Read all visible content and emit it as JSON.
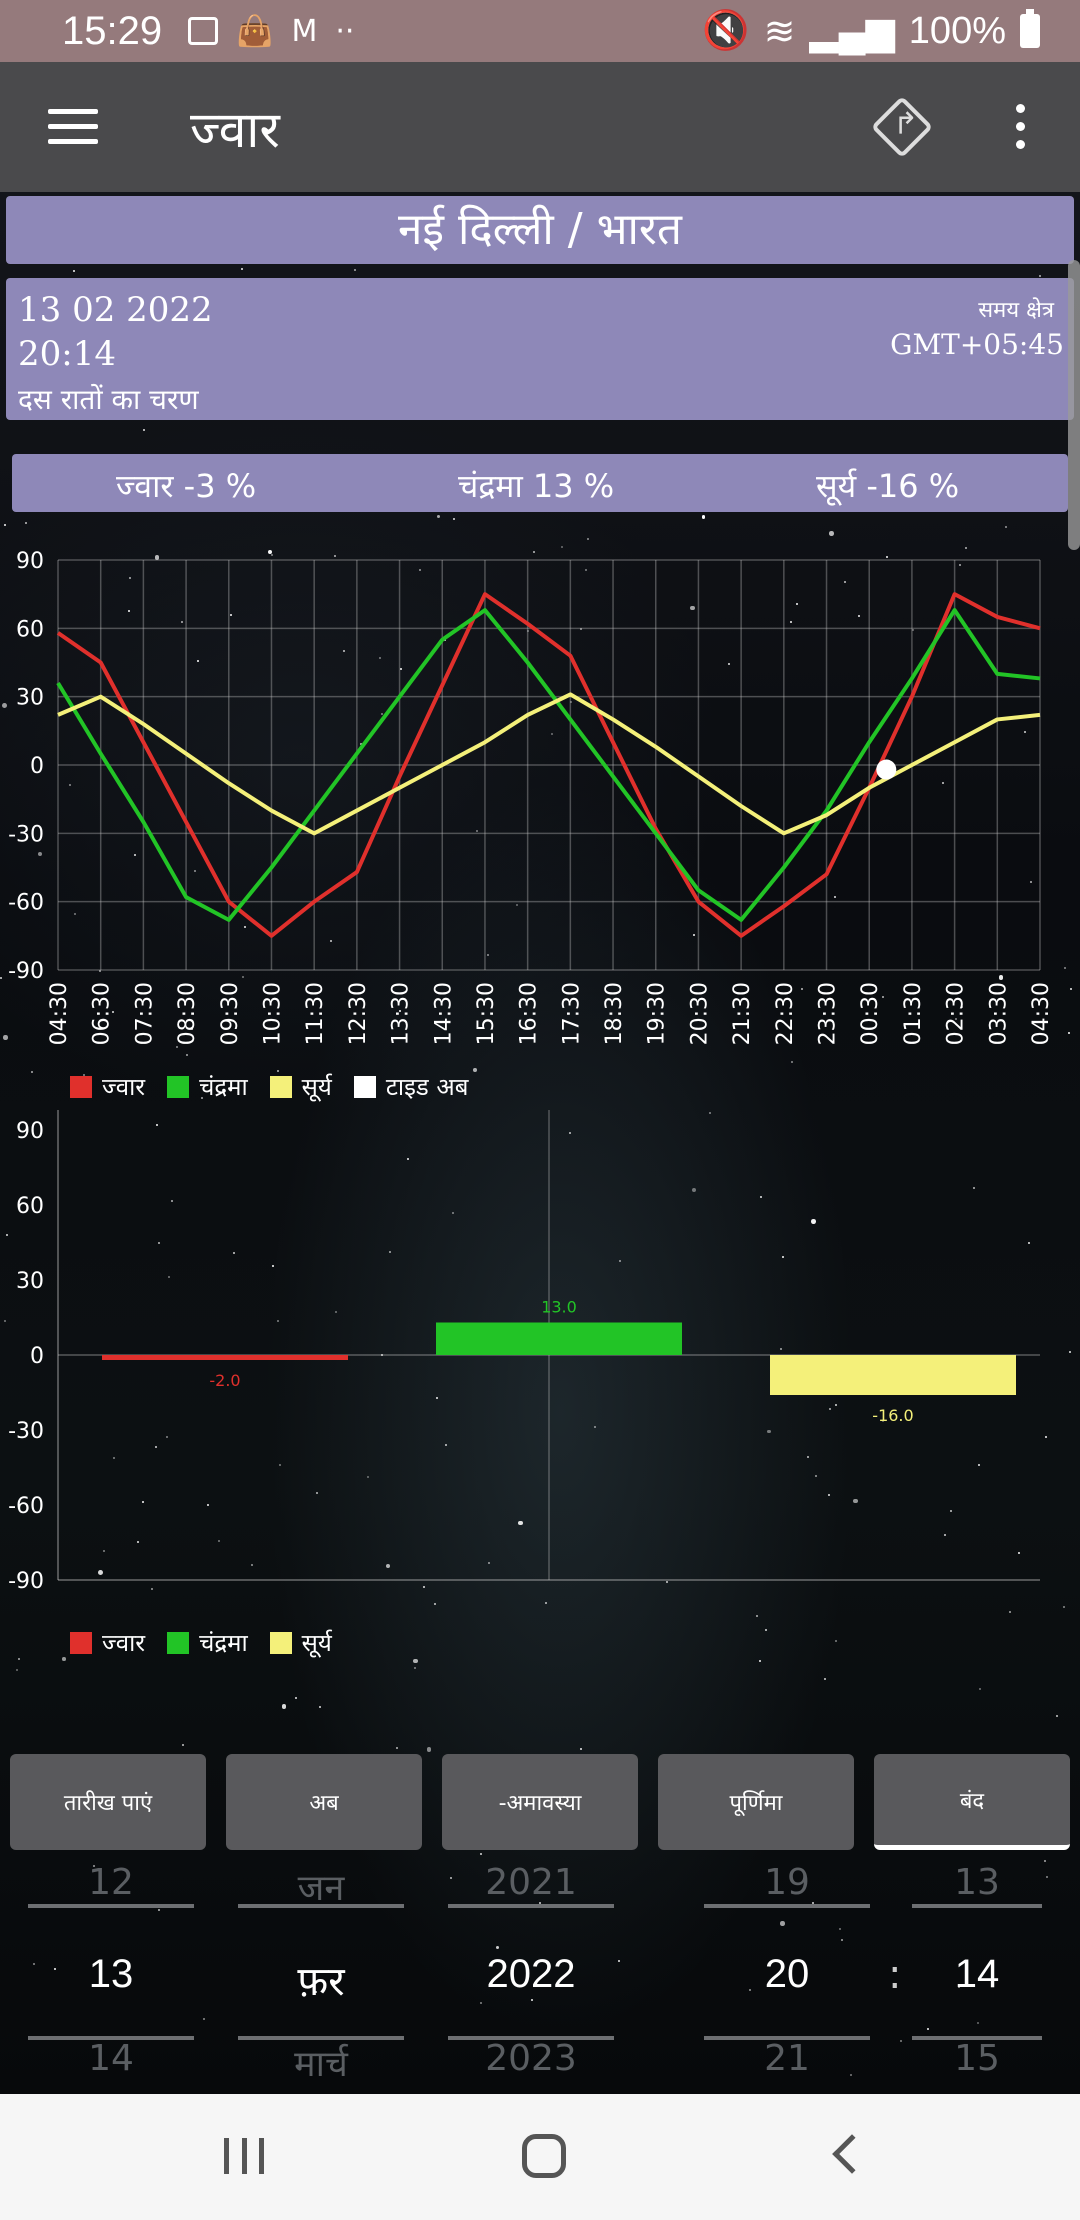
{
  "status_bar": {
    "time": "15:29",
    "battery": "100%",
    "icons": [
      "image-icon",
      "shopping-bag-icon",
      "gmail-icon",
      "more-dots-icon",
      "mute-icon",
      "wifi-icon",
      "signal-icon",
      "battery-icon"
    ]
  },
  "app_bar": {
    "title": "ज्वार"
  },
  "location": "नई दिल्ली / भारत",
  "info": {
    "date": "13 02 2022",
    "time": "20:14",
    "phase": "दस रातों का चरण",
    "timezone_label": "समय क्षेत्र",
    "timezone_value": "GMT+05:45"
  },
  "percentages": {
    "tide": "ज्वार  -3 %",
    "moon": "चंद्रमा  13 %",
    "sun": "सूर्य  -16 %"
  },
  "colors": {
    "tide": "#e0302c",
    "moon": "#22c426",
    "sun": "#f4f07a",
    "now": "#ffffff",
    "panel": "#8e88b8"
  },
  "chart_data": [
    {
      "type": "line",
      "x": [
        "04:30",
        "06:30",
        "07:30",
        "08:30",
        "09:30",
        "10:30",
        "11:30",
        "12:30",
        "13:30",
        "14:30",
        "15:30",
        "16:30",
        "17:30",
        "18:30",
        "19:30",
        "20:30",
        "21:30",
        "22:30",
        "23:30",
        "00:30",
        "01:30",
        "02:30",
        "03:30",
        "04:30"
      ],
      "ylim": [
        -90,
        90
      ],
      "yticks": [
        "90",
        "60",
        "30",
        "0",
        "-30",
        "-60",
        "-90"
      ],
      "grid": true,
      "legend_position": "bottom-left",
      "series": [
        {
          "name": "ज्वार",
          "values": [
            58,
            45,
            10,
            -25,
            -60,
            -75,
            -60,
            -47,
            -5,
            35,
            75,
            62,
            48,
            10,
            -28,
            -60,
            -75,
            -62,
            -48,
            -10,
            30,
            75,
            65,
            60
          ]
        },
        {
          "name": "चंद्रमा",
          "values": [
            36,
            5,
            -25,
            -58,
            -68,
            -45,
            -20,
            5,
            30,
            55,
            68,
            45,
            20,
            -5,
            -30,
            -55,
            -68,
            -45,
            -20,
            10,
            38,
            68,
            40,
            38
          ]
        },
        {
          "name": "सूर्य",
          "values": [
            22,
            30,
            18,
            5,
            -8,
            -20,
            -30,
            -20,
            -10,
            0,
            10,
            22,
            31,
            20,
            8,
            -5,
            -18,
            -30,
            -22,
            -10,
            0,
            10,
            20,
            22
          ]
        }
      ],
      "now_marker": {
        "name": "टाइड अब",
        "x_index": 19.4,
        "y": -2
      }
    },
    {
      "type": "bar",
      "categories": [
        "ज्वार",
        "चंद्रमा",
        "सूर्य"
      ],
      "values": [
        -2.0,
        13.0,
        -16.0
      ],
      "data_labels": [
        "-2.0",
        "13.0",
        "-16.0"
      ],
      "ylim": [
        -90,
        90
      ],
      "yticks": [
        "90",
        "60",
        "30",
        "0",
        "-30",
        "-60",
        "-90"
      ],
      "legend_position": "bottom-left"
    }
  ],
  "buttons": {
    "find_date": "तारीख पाएं",
    "now": "अब",
    "new_moon": "-अमावस्या",
    "full_moon": "पूर्णिमा",
    "close": "बंद"
  },
  "pickers": {
    "day": {
      "prev": "12",
      "current": "13",
      "next": "14"
    },
    "month": {
      "prev": "जन",
      "current": "फ़र",
      "next": "मार्च"
    },
    "year": {
      "prev": "2021",
      "current": "2022",
      "next": "2023"
    },
    "hour": {
      "prev": "19",
      "current": "20",
      "next": "21"
    },
    "separator": ":",
    "minute": {
      "prev": "13",
      "current": "14",
      "next": "15"
    }
  }
}
